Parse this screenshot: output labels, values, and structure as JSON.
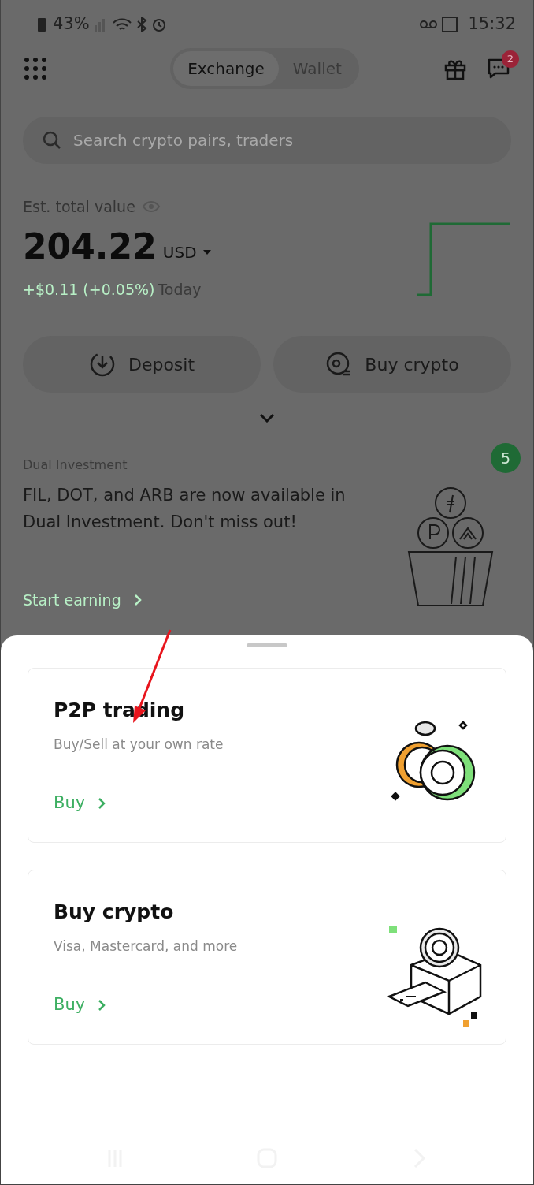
{
  "status_bar": {
    "battery": "43%",
    "time": "15:32"
  },
  "header": {
    "tabs": [
      {
        "label": "Exchange",
        "selected": true
      },
      {
        "label": "Wallet",
        "selected": false
      }
    ],
    "chat_badge": "2"
  },
  "search": {
    "placeholder": "Search crypto pairs, traders"
  },
  "balance": {
    "label": "Est. total value",
    "value": "204.22",
    "currency": "USD",
    "change": "+$0.11 (+0.05%)",
    "period": "Today"
  },
  "actions": [
    {
      "label": "Deposit",
      "kind": "deposit"
    },
    {
      "label": "Buy crypto",
      "kind": "buy"
    }
  ],
  "promo": {
    "category": "Dual Investment",
    "message": "FIL, DOT, and ARB are now available in Dual Investment. Don't miss out!",
    "link": "Start earning",
    "badge": "5"
  },
  "sheet": {
    "options": [
      {
        "kind": "p2p",
        "title": "P2P trading",
        "subtitle": "Buy/Sell at your own rate",
        "action": "Buy"
      },
      {
        "kind": "card",
        "title": "Buy crypto",
        "subtitle": "Visa, Mastercard, and more",
        "action": "Buy"
      }
    ]
  }
}
